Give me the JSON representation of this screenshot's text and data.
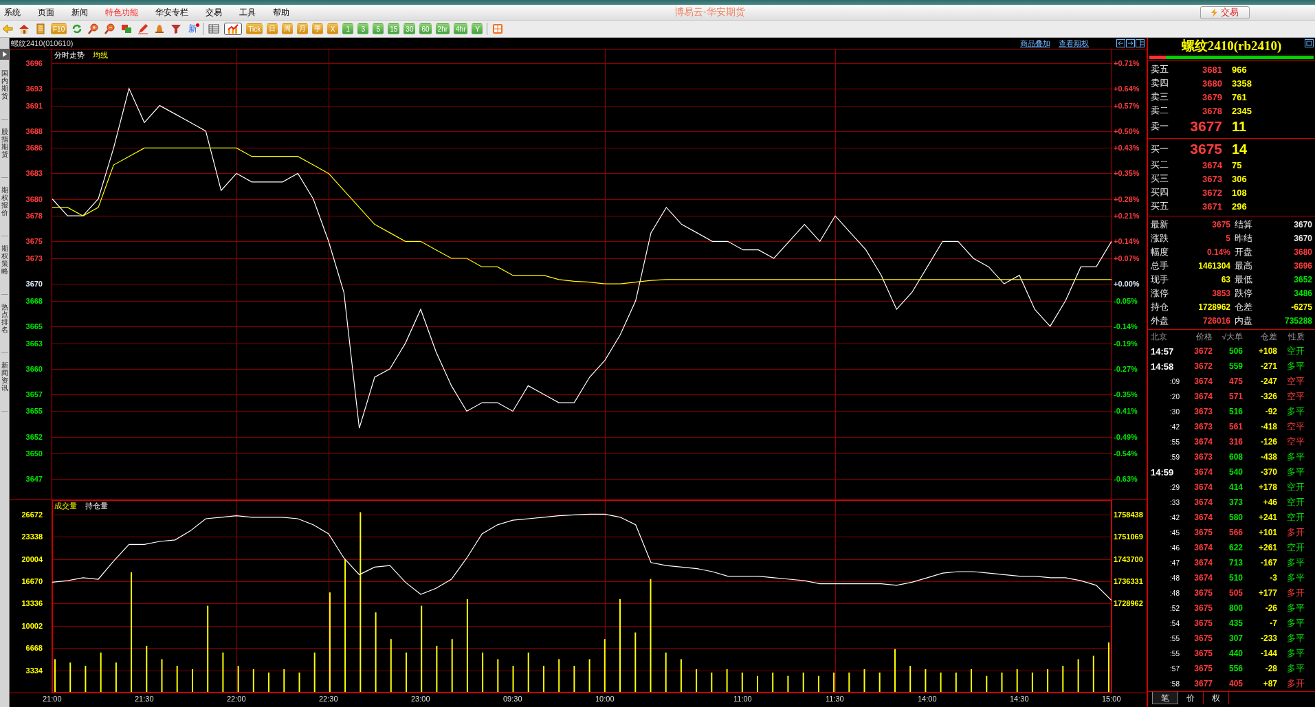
{
  "app": {
    "title": "博易云-华安期货",
    "menu": [
      {
        "label": "系统",
        "highlight": false
      },
      {
        "label": "页面",
        "highlight": false
      },
      {
        "label": "新闻",
        "highlight": false
      },
      {
        "label": "特色功能",
        "highlight": true
      },
      {
        "label": "华安专栏",
        "highlight": false
      },
      {
        "label": "交易",
        "highlight": false
      },
      {
        "label": "工具",
        "highlight": false
      },
      {
        "label": "帮助",
        "highlight": false
      }
    ],
    "trade_button": "交易"
  },
  "toolbar": [
    {
      "kind": "icon",
      "selected": false
    },
    {
      "kind": "icon",
      "selected": false
    },
    {
      "kind": "icon",
      "selected": false
    },
    {
      "kind": "badge",
      "label": "F10",
      "selected": false
    },
    {
      "kind": "icon",
      "selected": false
    },
    {
      "kind": "icon",
      "selected": false
    },
    {
      "kind": "icon",
      "selected": false
    },
    {
      "kind": "icon",
      "selected": false
    },
    {
      "kind": "icon",
      "selected": false
    },
    {
      "kind": "icon",
      "selected": false
    },
    {
      "kind": "icon",
      "selected": false
    },
    {
      "kind": "text",
      "label": "新",
      "selected": false
    },
    {
      "kind": "separator"
    },
    {
      "kind": "icon",
      "selected": false
    },
    {
      "kind": "icon",
      "selected": true
    },
    {
      "kind": "badge",
      "label": "Tick",
      "selected": false
    },
    {
      "kind": "badge",
      "label": "日",
      "selected": false
    },
    {
      "kind": "badge",
      "label": "周",
      "selected": false
    },
    {
      "kind": "badge",
      "label": "月",
      "selected": false
    },
    {
      "kind": "badge",
      "label": "季",
      "selected": false
    },
    {
      "kind": "badge",
      "label": "X",
      "selected": false
    },
    {
      "kind": "pill",
      "label": "1",
      "selected": false
    },
    {
      "kind": "pill",
      "label": "3",
      "selected": false
    },
    {
      "kind": "pill",
      "label": "5",
      "selected": false
    },
    {
      "kind": "pill",
      "label": "15",
      "selected": false
    },
    {
      "kind": "pill",
      "label": "30",
      "selected": false
    },
    {
      "kind": "pill",
      "label": "60",
      "selected": false
    },
    {
      "kind": "pill",
      "label": "2hr",
      "selected": false
    },
    {
      "kind": "pill",
      "label": "4hr",
      "selected": false
    },
    {
      "kind": "pill",
      "label": "Y",
      "selected": false
    },
    {
      "kind": "separator"
    },
    {
      "kind": "icon",
      "selected": false
    }
  ],
  "sidebar": {
    "tabs": [
      "国内期货",
      "股指期货",
      "期权报价",
      "期权策略",
      "热点排名",
      "新闻资讯"
    ]
  },
  "chart_header": {
    "instrument": "螺纹2410(010610)",
    "links": [
      "商品叠加",
      "查看期权"
    ]
  },
  "price_chart": {
    "chart_data": {
      "type": "line",
      "grid": true,
      "ylim": [
        3644.6,
        3697.6
      ],
      "series": [
        {
          "name": "分时走势",
          "color": "#ffffff",
          "values": [
            3680,
            3678,
            3678,
            3680,
            3686,
            3693,
            3689,
            3691,
            3690,
            3689,
            3688,
            3681,
            3683,
            3682,
            3682,
            3682,
            3683,
            3680,
            3675,
            3669,
            3653,
            3659,
            3660,
            3663,
            3667,
            3662,
            3658,
            3655,
            3656,
            3656,
            3655,
            3658,
            3657,
            3656,
            3656,
            3659,
            3661,
            3664,
            3668,
            3676,
            3679,
            3677,
            3676,
            3675,
            3675,
            3674,
            3674,
            3673,
            3675,
            3677,
            3675,
            3678,
            3676,
            3674,
            3671,
            3667,
            3669,
            3672,
            3675,
            3675,
            3673,
            3672,
            3670,
            3671,
            3667,
            3665,
            3668,
            3672,
            3672,
            3675
          ]
        },
        {
          "name": "均线",
          "color": "#ffff00",
          "values": [
            3679,
            3679,
            3678,
            3679,
            3684,
            3685,
            3686,
            3686,
            3686,
            3686,
            3686,
            3686,
            3686,
            3685,
            3685,
            3685,
            3685,
            3684,
            3683,
            3681,
            3679,
            3677,
            3676,
            3675,
            3675,
            3674,
            3673,
            3673,
            3672,
            3672,
            3671,
            3671,
            3671,
            3670.5,
            3670.3,
            3670.2,
            3670,
            3670,
            3670.2,
            3670.4,
            3670.5,
            3670.5,
            3670.5,
            3670.5,
            3670.5,
            3670.5,
            3670.5,
            3670.5,
            3670.5,
            3670.5,
            3670.5,
            3670.5,
            3670.5,
            3670.5,
            3670.5,
            3670.5,
            3670.5,
            3670.5,
            3670.5,
            3670.5,
            3670.5,
            3670.5,
            3670.5,
            3670.5,
            3670.5,
            3670.5,
            3670.5,
            3670.5,
            3670.5,
            3670.5
          ]
        }
      ],
      "yticks": [
        3647,
        3650,
        3652,
        3655,
        3657,
        3660,
        3663,
        3665,
        3668,
        3670,
        3673,
        3675,
        3678,
        3680,
        3683,
        3686,
        3688,
        3691,
        3693,
        3696
      ]
    },
    "percent_labels": [
      {
        "label": "+0.71%",
        "color": "#ff3c3c"
      },
      {
        "label": "+0.64%",
        "color": "#ff3c3c"
      },
      {
        "label": "+0.57%",
        "color": "#ff3c3c"
      },
      {
        "label": "+0.50%",
        "color": "#ff3c3c"
      },
      {
        "label": "+0.43%",
        "color": "#ff3c3c"
      },
      {
        "label": "+0.35%",
        "color": "#ff3c3c"
      },
      {
        "label": "+0.28%",
        "color": "#ff3c3c"
      },
      {
        "label": "+0.21%",
        "color": "#ff3c3c"
      },
      {
        "label": "+0.14%",
        "color": "#ff3c3c"
      },
      {
        "label": "+0.07%",
        "color": "#ff3c3c"
      },
      {
        "label": "+0.00%",
        "color": "#e0f0ff"
      },
      {
        "label": "-0.05%",
        "color": "#00e600"
      },
      {
        "label": "-0.14%",
        "color": "#00e600"
      },
      {
        "label": "-0.19%",
        "color": "#00e600"
      },
      {
        "label": "-0.27%",
        "color": "#00e600"
      },
      {
        "label": "-0.35%",
        "color": "#00e600"
      },
      {
        "label": "-0.41%",
        "color": "#00e600"
      },
      {
        "label": "-0.49%",
        "color": "#00e600"
      },
      {
        "label": "-0.54%",
        "color": "#00e600"
      },
      {
        "label": "-0.63%",
        "color": "#00e600"
      }
    ]
  },
  "volume_chart": {
    "chart_data": {
      "type": "bar",
      "grid": true,
      "ylim": [
        0,
        28800
      ],
      "categories": [
        "21:00",
        null,
        null,
        null,
        null,
        null,
        "21:30",
        null,
        null,
        null,
        null,
        null,
        "22:00",
        null,
        null,
        null,
        null,
        null,
        "22:30",
        null,
        null,
        null,
        null,
        null,
        "23:00",
        null,
        null,
        null,
        null,
        null,
        "09:30",
        null,
        null,
        null,
        null,
        null,
        "10:00",
        null,
        null,
        null,
        null,
        null,
        null,
        null,
        null,
        "11:00",
        null,
        null,
        null,
        null,
        null,
        "11:30",
        null,
        null,
        null,
        null,
        null,
        "14:00",
        null,
        null,
        null,
        null,
        null,
        "14:30",
        null,
        null,
        null,
        null,
        null,
        "15:00"
      ],
      "series": [
        {
          "name": "成交量",
          "color": "#ffff00",
          "values": [
            5000,
            4500,
            4000,
            6000,
            4500,
            18000,
            7000,
            5000,
            4000,
            3500,
            13000,
            6000,
            4000,
            3500,
            3000,
            3500,
            3000,
            6000,
            15000,
            20000,
            27000,
            12000,
            8000,
            6000,
            13000,
            7000,
            8000,
            14000,
            6000,
            5000,
            4000,
            6000,
            4000,
            5000,
            4000,
            5000,
            8000,
            14000,
            9000,
            17000,
            6000,
            5000,
            3500,
            3000,
            3500,
            3000,
            2500,
            3000,
            2500,
            3000,
            2500,
            3000,
            3000,
            3500,
            3000,
            6500,
            4000,
            3500,
            3000,
            3000,
            3500,
            2500,
            3000,
            3500,
            3000,
            3500,
            4000,
            5000,
            5500,
            7500
          ]
        }
      ],
      "yticks": [
        3334,
        6668,
        10002,
        13336,
        16670,
        20004,
        23338,
        26672
      ]
    }
  },
  "open_interest_chart": {
    "chart_data": {
      "type": "line",
      "ylim": [
        1699486,
        1763141
      ],
      "series": [
        {
          "name": "持仓量",
          "color": "#ffffff",
          "values": [
            1736000,
            1736500,
            1737500,
            1737000,
            1743000,
            1748500,
            1748500,
            1749500,
            1750000,
            1753000,
            1757000,
            1757500,
            1758000,
            1757500,
            1757500,
            1757500,
            1757000,
            1755000,
            1752000,
            1744000,
            1738500,
            1741000,
            1741500,
            1736000,
            1732000,
            1734000,
            1737000,
            1744000,
            1752000,
            1755000,
            1756500,
            1757000,
            1757500,
            1758000,
            1758300,
            1758500,
            1758500,
            1757500,
            1755000,
            1742500,
            1741500,
            1741000,
            1740500,
            1739500,
            1738000,
            1738000,
            1738000,
            1737500,
            1737000,
            1736500,
            1735500,
            1735500,
            1735500,
            1735500,
            1735500,
            1735000,
            1736000,
            1737500,
            1739000,
            1739500,
            1739500,
            1739000,
            1738500,
            1738000,
            1738000,
            1737500,
            1737500,
            1736500,
            1735000,
            1730000
          ]
        }
      ],
      "yticks": [
        1728962,
        1736331,
        1743700,
        1751069,
        1758438
      ]
    }
  },
  "quote": {
    "title": "螺纹2410(rb2410)",
    "level": 0.1,
    "asks": [
      {
        "label": "卖五",
        "price": "3681",
        "volume": "966",
        "kind": "level"
      },
      {
        "label": "卖四",
        "price": "3680",
        "volume": "3358",
        "kind": "level"
      },
      {
        "label": "卖三",
        "price": "3679",
        "volume": "761",
        "kind": "level"
      },
      {
        "label": "卖二",
        "price": "3678",
        "volume": "2345",
        "kind": "level"
      },
      {
        "label": "卖一",
        "price": "3677",
        "volume": "11",
        "kind": "best"
      }
    ],
    "bids": [
      {
        "label": "买一",
        "price": "3675",
        "volume": "14",
        "kind": "best"
      },
      {
        "label": "买二",
        "price": "3674",
        "volume": "75",
        "kind": "level"
      },
      {
        "label": "买三",
        "price": "3673",
        "volume": "306",
        "kind": "level"
      },
      {
        "label": "买四",
        "price": "3672",
        "volume": "108",
        "kind": "level"
      },
      {
        "label": "买五",
        "price": "3671",
        "volume": "296",
        "kind": "level"
      }
    ],
    "stats": [
      {
        "label": "最新",
        "value": "3675",
        "color": "#ff3c3c"
      },
      {
        "label": "结算",
        "value": "3670",
        "color": "#e8e8e8"
      },
      {
        "label": "涨跌",
        "value": "5",
        "color": "#ff3c3c"
      },
      {
        "label": "昨结",
        "value": "3670",
        "color": "#e8e8e8"
      },
      {
        "label": "幅度",
        "value": "0.14%",
        "color": "#ff3c3c"
      },
      {
        "label": "开盘",
        "value": "3680",
        "color": "#ff3c3c"
      },
      {
        "label": "总手",
        "value": "1461304",
        "color": "#ffff00"
      },
      {
        "label": "最高",
        "value": "3696",
        "color": "#ff3c3c"
      },
      {
        "label": "现手",
        "value": "63",
        "color": "#ffff00"
      },
      {
        "label": "最低",
        "value": "3652",
        "color": "#00e600"
      },
      {
        "label": "涨停",
        "value": "3853",
        "color": "#ff3c3c"
      },
      {
        "label": "跌停",
        "value": "3486",
        "color": "#00e600"
      },
      {
        "label": "持仓",
        "value": "1728962",
        "color": "#ffff00"
      },
      {
        "label": "仓差",
        "value": "-6275",
        "color": "#ffff00"
      },
      {
        "label": "外盘",
        "value": "726016",
        "color": "#ff3c3c"
      },
      {
        "label": "内盘",
        "value": "735288",
        "color": "#00e600"
      }
    ]
  },
  "ticks": {
    "columns": [
      "北京",
      "价格",
      "√大单",
      "仓差",
      "性质"
    ],
    "rows": [
      {
        "time": "14:57",
        "kind": "minute",
        "price": "3672",
        "volume": "506",
        "change": "+108",
        "nature": "空开",
        "color": "#00e600"
      },
      {
        "time": "14:58",
        "kind": "minute",
        "price": "3672",
        "volume": "559",
        "change": "-271",
        "nature": "多平",
        "color": "#00e600"
      },
      {
        "time": ":09",
        "kind": "second",
        "price": "3674",
        "volume": "475",
        "change": "-247",
        "nature": "空平",
        "color": "#ff3c3c"
      },
      {
        "time": ":20",
        "kind": "second",
        "price": "3674",
        "volume": "571",
        "change": "-326",
        "nature": "空平",
        "color": "#ff3c3c"
      },
      {
        "time": ":30",
        "kind": "second",
        "price": "3673",
        "volume": "516",
        "change": "-92",
        "nature": "多平",
        "color": "#00e600"
      },
      {
        "time": ":42",
        "kind": "second",
        "price": "3673",
        "volume": "561",
        "change": "-418",
        "nature": "空平",
        "color": "#ff3c3c"
      },
      {
        "time": ":55",
        "kind": "second",
        "price": "3674",
        "volume": "316",
        "change": "-126",
        "nature": "空平",
        "color": "#ff3c3c"
      },
      {
        "time": ":59",
        "kind": "second",
        "price": "3673",
        "volume": "608",
        "change": "-438",
        "nature": "多平",
        "color": "#00e600"
      },
      {
        "time": "14:59",
        "kind": "minute",
        "price": "3674",
        "volume": "540",
        "change": "-370",
        "nature": "多平",
        "color": "#00e600"
      },
      {
        "time": ":29",
        "kind": "second",
        "price": "3674",
        "volume": "414",
        "change": "+178",
        "nature": "空开",
        "color": "#00e600"
      },
      {
        "time": ":33",
        "kind": "second",
        "price": "3674",
        "volume": "373",
        "change": "+46",
        "nature": "空开",
        "color": "#00e600"
      },
      {
        "time": ":42",
        "kind": "second",
        "price": "3674",
        "volume": "580",
        "change": "+241",
        "nature": "空开",
        "color": "#00e600"
      },
      {
        "time": ":45",
        "kind": "second",
        "price": "3675",
        "volume": "566",
        "change": "+101",
        "nature": "多开",
        "color": "#ff3c3c"
      },
      {
        "time": ":46",
        "kind": "second",
        "price": "3674",
        "volume": "622",
        "change": "+261",
        "nature": "空开",
        "color": "#00e600"
      },
      {
        "time": ":47",
        "kind": "second",
        "price": "3674",
        "volume": "713",
        "change": "-167",
        "nature": "多平",
        "color": "#00e600"
      },
      {
        "time": ":48",
        "kind": "second",
        "price": "3674",
        "volume": "510",
        "change": "-3",
        "nature": "多平",
        "color": "#00e600"
      },
      {
        "time": ":48",
        "kind": "second",
        "price": "3675",
        "volume": "505",
        "change": "+177",
        "nature": "多开",
        "color": "#ff3c3c"
      },
      {
        "time": ":52",
        "kind": "second",
        "price": "3675",
        "volume": "800",
        "change": "-26",
        "nature": "多平",
        "color": "#00e600"
      },
      {
        "time": ":54",
        "kind": "second",
        "price": "3675",
        "volume": "435",
        "change": "-7",
        "nature": "多平",
        "color": "#00e600"
      },
      {
        "time": ":55",
        "kind": "second",
        "price": "3675",
        "volume": "307",
        "change": "-233",
        "nature": "多平",
        "color": "#00e600"
      },
      {
        "time": ":55",
        "kind": "second",
        "price": "3675",
        "volume": "440",
        "change": "-144",
        "nature": "多平",
        "color": "#00e600"
      },
      {
        "time": ":57",
        "kind": "second",
        "price": "3675",
        "volume": "556",
        "change": "-28",
        "nature": "多平",
        "color": "#00e600"
      },
      {
        "time": ":58",
        "kind": "second",
        "price": "3677",
        "volume": "405",
        "change": "+87",
        "nature": "多开",
        "color": "#ff3c3c"
      }
    ],
    "tabs": [
      {
        "label": "笔",
        "selected": true
      },
      {
        "label": "价",
        "selected": false
      },
      {
        "label": "权",
        "selected": false
      }
    ]
  }
}
